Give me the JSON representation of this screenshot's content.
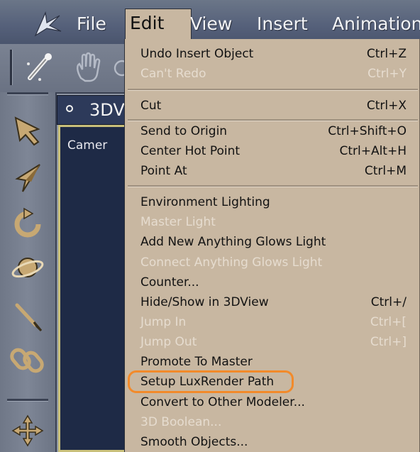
{
  "menubar": {
    "items": [
      {
        "label": "File"
      },
      {
        "label": "Edit"
      },
      {
        "label": "View"
      },
      {
        "label": "Insert"
      },
      {
        "label": "Animation"
      }
    ]
  },
  "viewport": {
    "title": "3DV",
    "camera_label": "Camer"
  },
  "edit_menu": {
    "items": [
      {
        "label": "Undo Insert Object",
        "shortcut": "Ctrl+Z",
        "enabled": true
      },
      {
        "label": "Can't Redo",
        "shortcut": "Ctrl+Y",
        "enabled": false
      },
      {
        "label": "Cut",
        "shortcut": "Ctrl+X",
        "enabled": true
      },
      {
        "label": "Send to Origin",
        "shortcut": "Ctrl+Shift+O",
        "enabled": true
      },
      {
        "label": "Center Hot Point",
        "shortcut": "Ctrl+Alt+H",
        "enabled": true
      },
      {
        "label": "Point At",
        "shortcut": "Ctrl+M",
        "enabled": true
      },
      {
        "label": "Environment Lighting",
        "shortcut": "",
        "enabled": true
      },
      {
        "label": "Master Light",
        "shortcut": "",
        "enabled": false
      },
      {
        "label": "Add New Anything Glows Light",
        "shortcut": "",
        "enabled": true
      },
      {
        "label": "Connect Anything Glows Light",
        "shortcut": "",
        "enabled": false
      },
      {
        "label": "Counter...",
        "shortcut": "",
        "enabled": true
      },
      {
        "label": "Hide/Show in 3DView",
        "shortcut": "Ctrl+/",
        "enabled": true
      },
      {
        "label": "Jump In",
        "shortcut": "Ctrl+[",
        "enabled": false
      },
      {
        "label": "Jump Out",
        "shortcut": "Ctrl+]",
        "enabled": false
      },
      {
        "label": "Promote To Master",
        "shortcut": "",
        "enabled": true
      },
      {
        "label": "Setup LuxRender Path",
        "shortcut": "",
        "enabled": true,
        "highlighted": true
      },
      {
        "label": "Convert to Other Modeler...",
        "shortcut": "",
        "enabled": true
      },
      {
        "label": "3D Boolean...",
        "shortcut": "",
        "enabled": false
      },
      {
        "label": "Smooth Objects...",
        "shortcut": "",
        "enabled": true
      }
    ]
  },
  "colors": {
    "menu_bg": "#c8b7a1",
    "highlight_ring": "#f28a2a",
    "disabled_text": "#e6dccf",
    "menubar_bg": "#55607a",
    "viewport_bg": "#1e2a46"
  },
  "icons": {
    "toolbar": [
      "magic-wand-icon",
      "grab-hand-icon"
    ],
    "left_strip": [
      "select-arrow-icon",
      "move-arrow-icon",
      "rotate-icon",
      "orbit-icon",
      "paint-brush-icon",
      "link-chain-icon",
      "pan-cross-icon"
    ]
  }
}
